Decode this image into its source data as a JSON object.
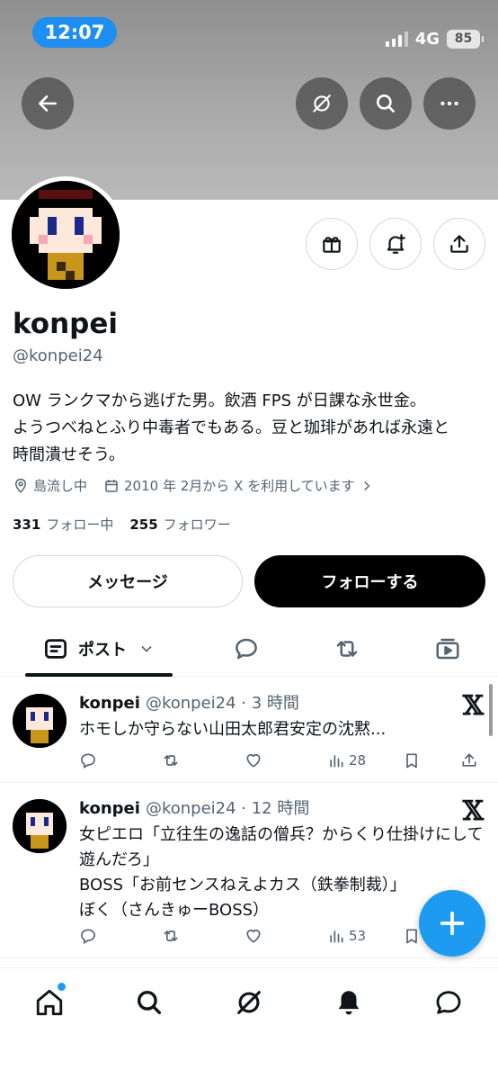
{
  "status_bar": {
    "time": "12:07",
    "network": "4G",
    "battery": "85"
  },
  "profile": {
    "display_name": "konpei",
    "handle": "@konpei24",
    "bio_lines": [
      "OW ランクマから逃げた男。飲酒 FPS が日課な永世金。",
      "ようつべねとふり中毒者でもある。豆と珈琲があれば永遠と",
      "時間潰せそう。"
    ],
    "location": "島流し中",
    "joined": "2010 年 2月から X を利用しています",
    "following_count": "331",
    "following_label": "フォロー中",
    "followers_count": "255",
    "followers_label": "フォロワー"
  },
  "buttons": {
    "message": "メッセージ",
    "follow": "フォローする"
  },
  "tabs": {
    "posts_label": "ポスト"
  },
  "posts": [
    {
      "name": "konpei",
      "meta": "@konpei24 · 3 時間",
      "text": "ホモしか守らない山田太郎君安定の沈黙...",
      "views": "28"
    },
    {
      "name": "konpei",
      "meta": "@konpei24 · 12 時間",
      "text": "女ピエロ「立往生の逸話の僧兵？からくり仕掛けにして遊んだろ」\nBOSS「お前センスねえよカス（鉄拳制裁）」\nぼく（さんきゅーBOSS）",
      "views": "53"
    }
  ],
  "colors": {
    "accent": "#1d9bf0",
    "status_pill": "#1f8ef1",
    "text": "#0f1419",
    "secondary": "#536471"
  }
}
